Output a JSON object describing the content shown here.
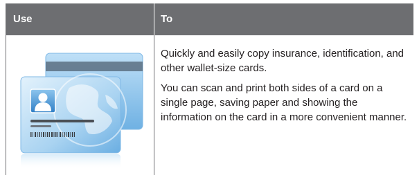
{
  "table": {
    "header": {
      "use": "Use",
      "to": "To"
    },
    "row": {
      "illustration_icon": "id-card-globe-icon",
      "paragraph_1": "Quickly and easily copy insurance, identification, and other wallet-size cards.",
      "paragraph_2": "You can scan and print both sides of a card on a single page, saving paper and showing the information on the card in a more convenient manner."
    }
  },
  "colors": {
    "header_bg": "#6d6e71",
    "header_text": "#ffffff",
    "body_text": "#231f20",
    "card_blue": "#7fb8e6"
  }
}
